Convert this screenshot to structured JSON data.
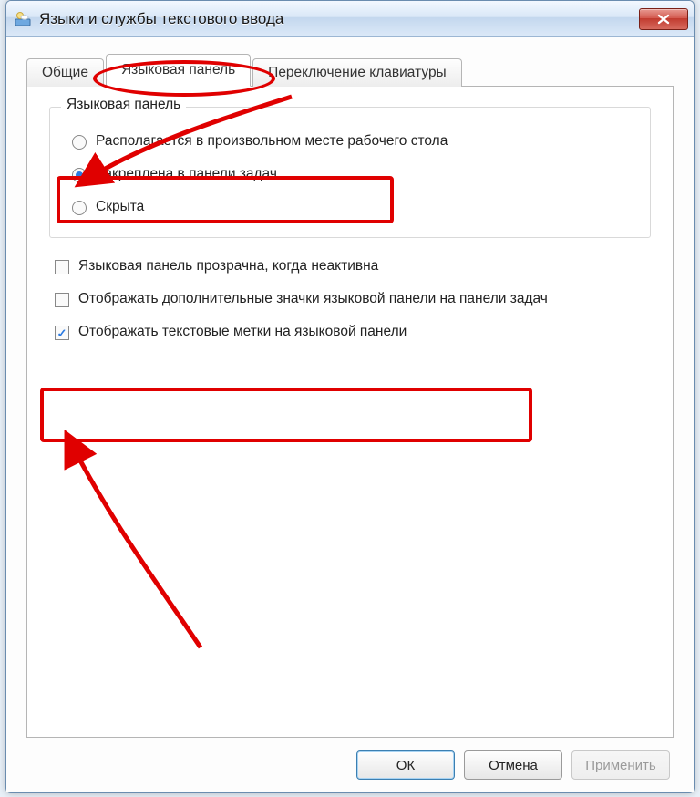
{
  "window": {
    "title": "Языки и службы текстового ввода"
  },
  "tabs": {
    "general": "Общие",
    "langbar": "Языковая панель",
    "hotkeys": "Переключение клавиатуры"
  },
  "fieldset": {
    "legend": "Языковая панель",
    "radio_float": "Располагается в произвольном месте рабочего стола",
    "radio_dock": "Закреплена в панели задач",
    "radio_hidden": "Скрыта"
  },
  "checks": {
    "transparent": "Языковая панель прозрачна, когда неактивна",
    "extra_icons": "Отображать дополнительные значки языковой панели на панели задач",
    "text_labels": "Отображать текстовые метки на языковой панели"
  },
  "buttons": {
    "ok": "ОК",
    "cancel": "Отмена",
    "apply": "Применить"
  }
}
